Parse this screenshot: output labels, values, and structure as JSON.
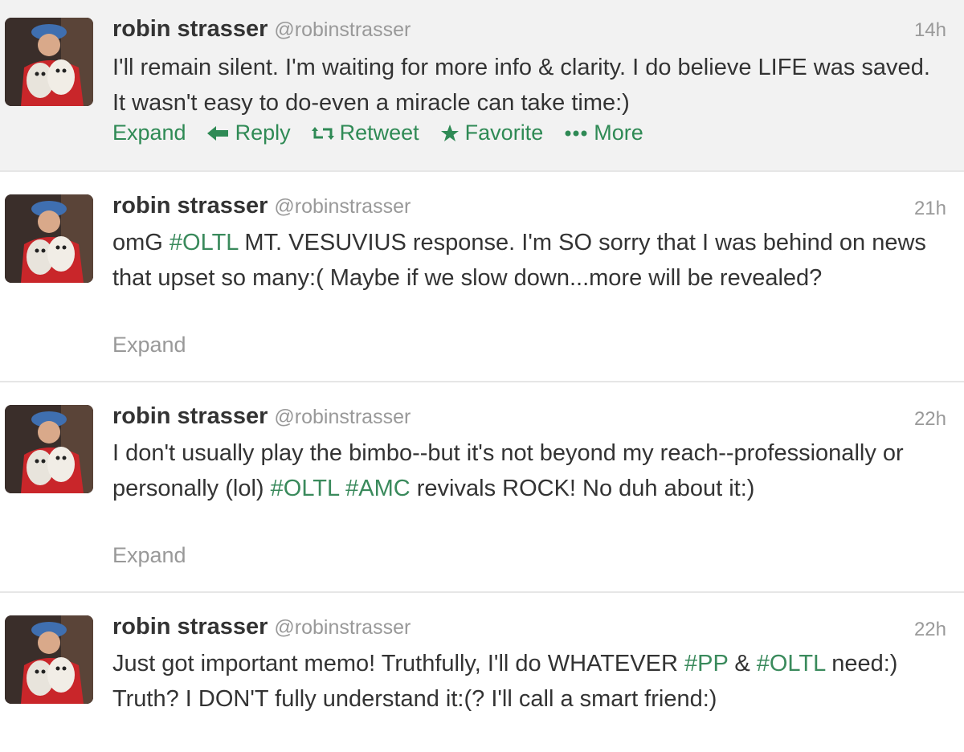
{
  "tweets": [
    {
      "name": "robin strasser",
      "handle": "@robinstrasser",
      "time": "14h",
      "text": [
        {
          "t": "I'll remain silent. I'm waiting for more info & clarity. I do believe LIFE was saved. It wasn't easy to do-even a miracle can take time:)"
        }
      ],
      "actions": {
        "expand": "Expand",
        "reply": "Reply",
        "retweet": "Retweet",
        "favorite": "Favorite",
        "more": "More"
      }
    },
    {
      "name": "robin strasser",
      "handle": "@robinstrasser",
      "time": "21h",
      "text": [
        {
          "t": "omG "
        },
        {
          "t": "#OLTL",
          "tag": true
        },
        {
          "t": " MT. VESUVIUS response. I'm SO sorry that I was behind on news that upset so many:( Maybe if we slow down...more will be revealed?"
        }
      ],
      "expand": "Expand"
    },
    {
      "name": "robin strasser",
      "handle": "@robinstrasser",
      "time": "22h",
      "text": [
        {
          "t": "I don't usually play the bimbo--but it's not beyond my reach--professionally or personally (lol) "
        },
        {
          "t": "#OLTL",
          "tag": true
        },
        {
          "t": " "
        },
        {
          "t": "#AMC",
          "tag": true
        },
        {
          "t": " revivals ROCK! No duh about it:)"
        }
      ],
      "expand": "Expand"
    },
    {
      "name": "robin strasser",
      "handle": "@robinstrasser",
      "time": "22h",
      "text": [
        {
          "t": "Just got important memo! Truthfully, I'll do WHATEVER "
        },
        {
          "t": "#PP",
          "tag": true
        },
        {
          "t": " & "
        },
        {
          "t": "#OLTL",
          "tag": true
        },
        {
          "t": " need:) Truth? I DON'T fully understand it:(? I'll call a smart friend:)"
        }
      ]
    }
  ],
  "colors": {
    "link_green": "#2f8a55",
    "hashtag_green": "#3a8a5c",
    "muted_gray": "#999999",
    "highlight_bg": "#f2f2f2"
  },
  "icons": {
    "reply": "reply-arrow-icon",
    "retweet": "retweet-icon",
    "favorite": "star-icon",
    "more": "more-dots-icon"
  }
}
